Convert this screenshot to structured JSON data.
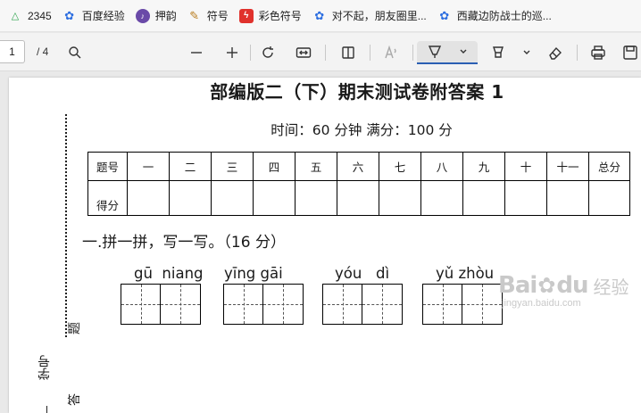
{
  "bookmarks": [
    {
      "label": "2345",
      "icon": "2345-logo-icon"
    },
    {
      "label": "百度经验",
      "icon": "baidu-paw-icon"
    },
    {
      "label": "押韵",
      "icon": "purple-logo-icon"
    },
    {
      "label": "符号",
      "icon": "pencil-icon"
    },
    {
      "label": "彩色符号",
      "icon": "red-bolt-icon"
    },
    {
      "label": "对不起，朋友圈里...",
      "icon": "baidu-paw-icon"
    },
    {
      "label": "西藏边防战士的巡...",
      "icon": "baidu-paw-icon"
    }
  ],
  "toolbar": {
    "page_current": "1",
    "page_total": "/ 4"
  },
  "document": {
    "title": "部编版二（下）期末测试卷附答案 1",
    "subtitle": "时间：60 分钟    满分：100 分",
    "table_headers": [
      "题号",
      "一",
      "二",
      "三",
      "四",
      "五",
      "六",
      "七",
      "八",
      "九",
      "十",
      "十一",
      "总分"
    ],
    "table_row2_label": "得分",
    "section1": "一.拼一拼，写一写。（16 分）",
    "pinyin": [
      {
        "text": "gū  niang",
        "cells": 4
      },
      {
        "text": "yīng gāi",
        "cells": 4
      },
      {
        "text": "yóu   dì",
        "cells": 4
      },
      {
        "text": "yǔ zhòu",
        "cells": 2
      }
    ],
    "margin_chars": {
      "ti": "题",
      "da": "答"
    },
    "margin_label": "学号"
  },
  "watermark": {
    "brand": "Bai",
    "brand2": "du",
    "cn": "经验",
    "url": "jingyan.baidu.com"
  }
}
